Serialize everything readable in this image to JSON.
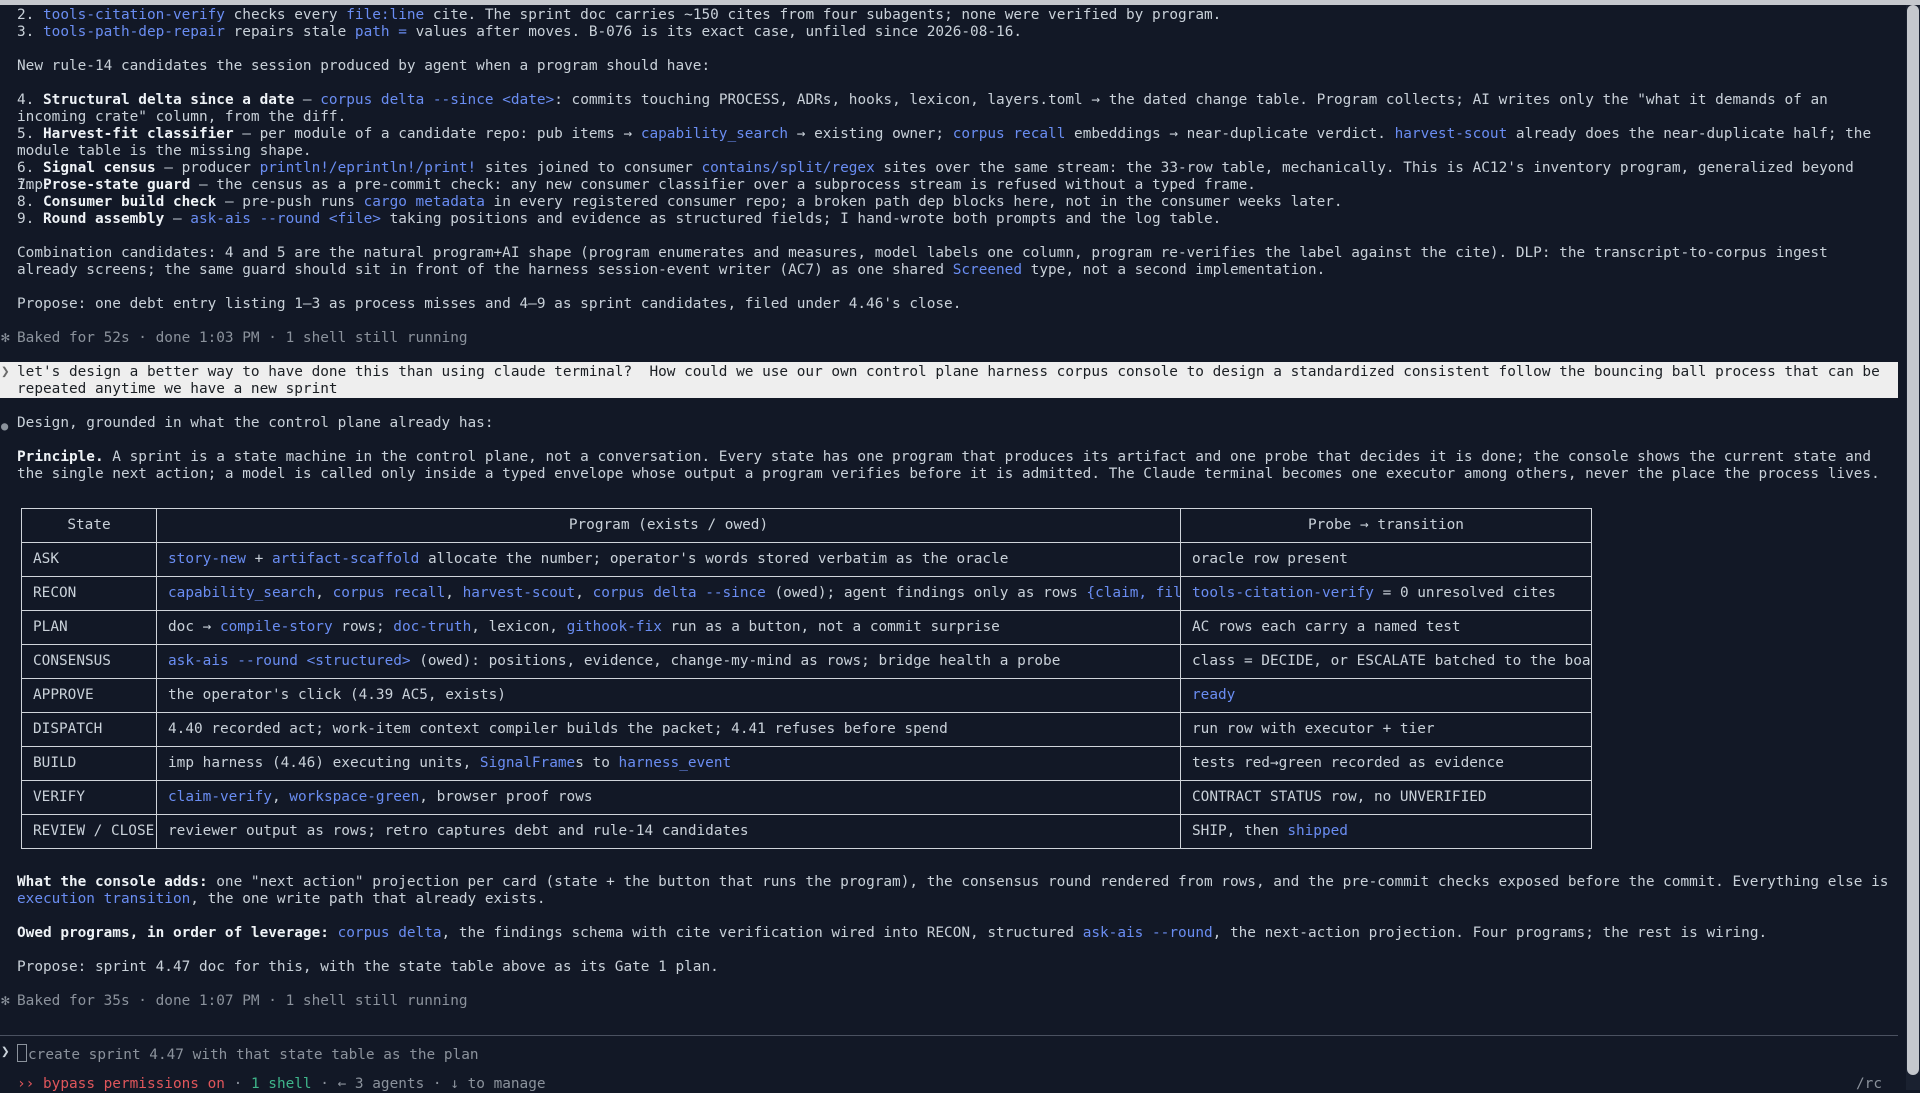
{
  "top": {
    "l2_pre": "2. ",
    "l2_cmd": "tools-citation-verify",
    "l2_a": " checks every ",
    "l2_fl": "file:line",
    "l2_b": " cite. The sprint doc carries ~150 cites from four subagents; none were verified by program.",
    "l3_pre": "3. ",
    "l3_cmd": "tools-path-dep-repair",
    "l3_a": " repairs stale ",
    "l3_code": "path =",
    "l3_b": " values after moves. B-076 is its exact case, unfiled since 2026-08-16.",
    "rule14_intro": "New rule-14 candidates the session produced by agent when a program should have:"
  },
  "candidates": {
    "c4_num": "4. ",
    "c4_title": "Structural delta since a date",
    "c4_dash": " — ",
    "c4_cmd": "corpus delta --since <date>",
    "c4_text": ": commits touching PROCESS, ADRs, hooks, lexicon, layers.toml → the dated change table. Program collects; AI writes only the \"what it demands of an incoming crate\" column, from the diff.",
    "c5_num": "5. ",
    "c5_title": "Harvest-fit classifier",
    "c5_a": " — per module of a candidate repo: pub items → ",
    "c5_cmd1": "capability_search",
    "c5_b": " → existing owner; ",
    "c5_cmd2": "corpus recall",
    "c5_c": " embeddings → near-duplicate verdict. ",
    "c5_cmd3": "harvest-scout",
    "c5_d": " already does the near-duplicate half; the module table is the missing shape.",
    "c6_num": "6. ",
    "c6_title": "Signal census",
    "c6_a": " — producer ",
    "c6_cmd1": "println!/eprintln!/print!",
    "c6_b": " sites joined to consumer ",
    "c6_cmd2": "contains/split/regex",
    "c6_c": " sites over the same stream: the 33-row table, mechanically. This is AC12's inventory program, generalized beyond imp.",
    "c7_num": "7. ",
    "c7_title": "Prose-state guard",
    "c7_text": " — the census as a pre-commit check: any new consumer classifier over a subprocess stream is refused without a typed frame.",
    "c8_num": "8. ",
    "c8_title": "Consumer build check",
    "c8_a": " — pre-push runs ",
    "c8_cmd": "cargo metadata",
    "c8_b": " in every registered consumer repo; a broken path dep blocks here, not in the consumer weeks later.",
    "c9_num": "9. ",
    "c9_title": "Round assembly",
    "c9_a": " — ",
    "c9_cmd": "ask-ais --round <file>",
    "c9_b": " taking positions and evidence as structured fields; I hand-wrote both prompts and the log table."
  },
  "combination": {
    "a": "Combination candidates: 4 and 5 are the natural program+AI shape (program enumerates and measures, model labels one column, program re-verifies the label against the cite). DLP: the transcript-to-corpus ingest already screens; the same guard should sit in front of the harness session-event writer (AC7) as one shared ",
    "cmd": "Screened",
    "b": " type, not a second implementation."
  },
  "propose1": "Propose: one debt entry listing 1–3 as process misses and 4–9 as sprint candidates, filed under 4.46's close.",
  "baked1": "Baked for 52s · done 1:03 PM · 1 shell still running",
  "user_message": "let's design a better way to have done this than using claude terminal?  How could we use our own control plane harness corpus console to design a standardized consistent follow the bouncing ball process that can be repeated anytime we have a new sprint",
  "design_intro": "Design, grounded in what the control plane already has:",
  "principle": {
    "label": "Principle.",
    "text": " A sprint is a state machine in the control plane, not a conversation. Every state has one program that produces its artifact and one probe that decides it is done; the console shows the current state and the single next action; a model is called only inside a typed envelope whose output a program verifies before it is admitted. The Claude terminal becomes one executor among others, never the place the process lives."
  },
  "state_table": {
    "headers": [
      "State",
      "Program (exists / owed)",
      "Probe → transition"
    ],
    "rows": [
      {
        "state": "ASK",
        "program": [
          {
            "t": "story-new",
            "l": true
          },
          {
            "t": " + ",
            "l": false
          },
          {
            "t": "artifact-scaffold",
            "l": true
          },
          {
            "t": " allocate the number; operator's words stored verbatim as the oracle",
            "l": false
          }
        ],
        "probe": [
          {
            "t": "oracle row present",
            "l": false
          }
        ]
      },
      {
        "state": "RECON",
        "program": [
          {
            "t": "capability_search",
            "l": true
          },
          {
            "t": ", ",
            "l": false
          },
          {
            "t": "corpus recall",
            "l": true
          },
          {
            "t": ", ",
            "l": false
          },
          {
            "t": "harvest-scout",
            "l": true
          },
          {
            "t": ", ",
            "l": false
          },
          {
            "t": "corpus delta --since",
            "l": true
          },
          {
            "t": " (owed); agent findings only as rows ",
            "l": false
          },
          {
            "t": "{claim, file, line}",
            "l": true
          }
        ],
        "probe": [
          {
            "t": "tools-citation-verify",
            "l": true
          },
          {
            "t": " = 0 unresolved cites",
            "l": false
          }
        ]
      },
      {
        "state": "PLAN",
        "program": [
          {
            "t": "doc → ",
            "l": false
          },
          {
            "t": "compile-story",
            "l": true
          },
          {
            "t": " rows; ",
            "l": false
          },
          {
            "t": "doc-truth",
            "l": true
          },
          {
            "t": ", lexicon, ",
            "l": false
          },
          {
            "t": "githook-fix",
            "l": true
          },
          {
            "t": " run as a button, not a commit surprise",
            "l": false
          }
        ],
        "probe": [
          {
            "t": "AC rows each carry a named test",
            "l": false
          }
        ]
      },
      {
        "state": "CONSENSUS",
        "program": [
          {
            "t": "ask-ais --round <structured>",
            "l": true
          },
          {
            "t": " (owed): positions, evidence, change-my-mind as rows; bridge health a probe",
            "l": false
          }
        ],
        "probe": [
          {
            "t": "class = DECIDE, or ESCALATE batched to the board",
            "l": false
          }
        ]
      },
      {
        "state": "APPROVE",
        "program": [
          {
            "t": "the operator's click (4.39 AC5, exists)",
            "l": false
          }
        ],
        "probe": [
          {
            "t": "ready",
            "l": true
          }
        ]
      },
      {
        "state": "DISPATCH",
        "program": [
          {
            "t": "4.40 recorded act; work-item context compiler builds the packet; 4.41 refuses before spend",
            "l": false
          }
        ],
        "probe": [
          {
            "t": "run row with executor + tier",
            "l": false
          }
        ]
      },
      {
        "state": "BUILD",
        "program": [
          {
            "t": "imp harness (4.46) executing units, ",
            "l": false
          },
          {
            "t": "SignalFrame",
            "l": true
          },
          {
            "t": "s to ",
            "l": false
          },
          {
            "t": "harness_event",
            "l": true
          }
        ],
        "probe": [
          {
            "t": "tests red→green recorded as evidence",
            "l": false
          }
        ]
      },
      {
        "state": "VERIFY",
        "program": [
          {
            "t": "claim-verify",
            "l": true
          },
          {
            "t": ", ",
            "l": false
          },
          {
            "t": "workspace-green",
            "l": true
          },
          {
            "t": ", browser proof rows",
            "l": false
          }
        ],
        "probe": [
          {
            "t": "CONTRACT STATUS row, no UNVERIFIED",
            "l": false
          }
        ]
      },
      {
        "state": "REVIEW / CLOSE",
        "program": [
          {
            "t": "reviewer output as rows; retro captures debt and rule-14 candidates",
            "l": false
          }
        ],
        "probe": [
          {
            "t": "SHIP, then ",
            "l": false
          },
          {
            "t": "shipped",
            "l": true
          }
        ]
      }
    ]
  },
  "console_adds": {
    "label": "What the console adds:",
    "a": " one \"next action\" projection per card (state + the button that runs the program), the consensus round rendered from rows, and the pre-commit checks exposed before the commit. Everything else is ",
    "cmd": "execution transition",
    "b": ", the one write path that already exists."
  },
  "owed": {
    "label": "Owed programs, in order of leverage:",
    "a": " ",
    "cmd1": "corpus delta",
    "b": ", the findings schema with cite verification wired into RECON, structured ",
    "cmd2": "ask-ais --round",
    "c": ", the next-action projection. Four programs; the rest is wiring."
  },
  "propose2": "Propose: sprint 4.47 doc for this, with the state table above as its Gate 1 plan.",
  "baked2": "Baked for 35s · done 1:07 PM · 1 shell still running",
  "input": {
    "prompt_char": "❯",
    "first_char": "c",
    "rest": "reate sprint 4.47 with that state table as the plan"
  },
  "statusbar": {
    "arrows": "››",
    "bypass": "bypass permissions on",
    "sep1": " · ",
    "shell": "1 shell",
    "sep2": " · ",
    "agents": "← 3 agents",
    "sep3": " · ",
    "manage": "↓ to manage",
    "right": "/rc"
  },
  "glyphs": {
    "bullet": "●",
    "spinner": "✻",
    "caret": "❯"
  },
  "colors": {
    "background": "#121826",
    "text": "#c9d1d9",
    "link": "#6a8df2",
    "dim": "#8b929c",
    "user_bg": "#eeeeee",
    "error": "#e0565b",
    "shell": "#3fb68b"
  }
}
